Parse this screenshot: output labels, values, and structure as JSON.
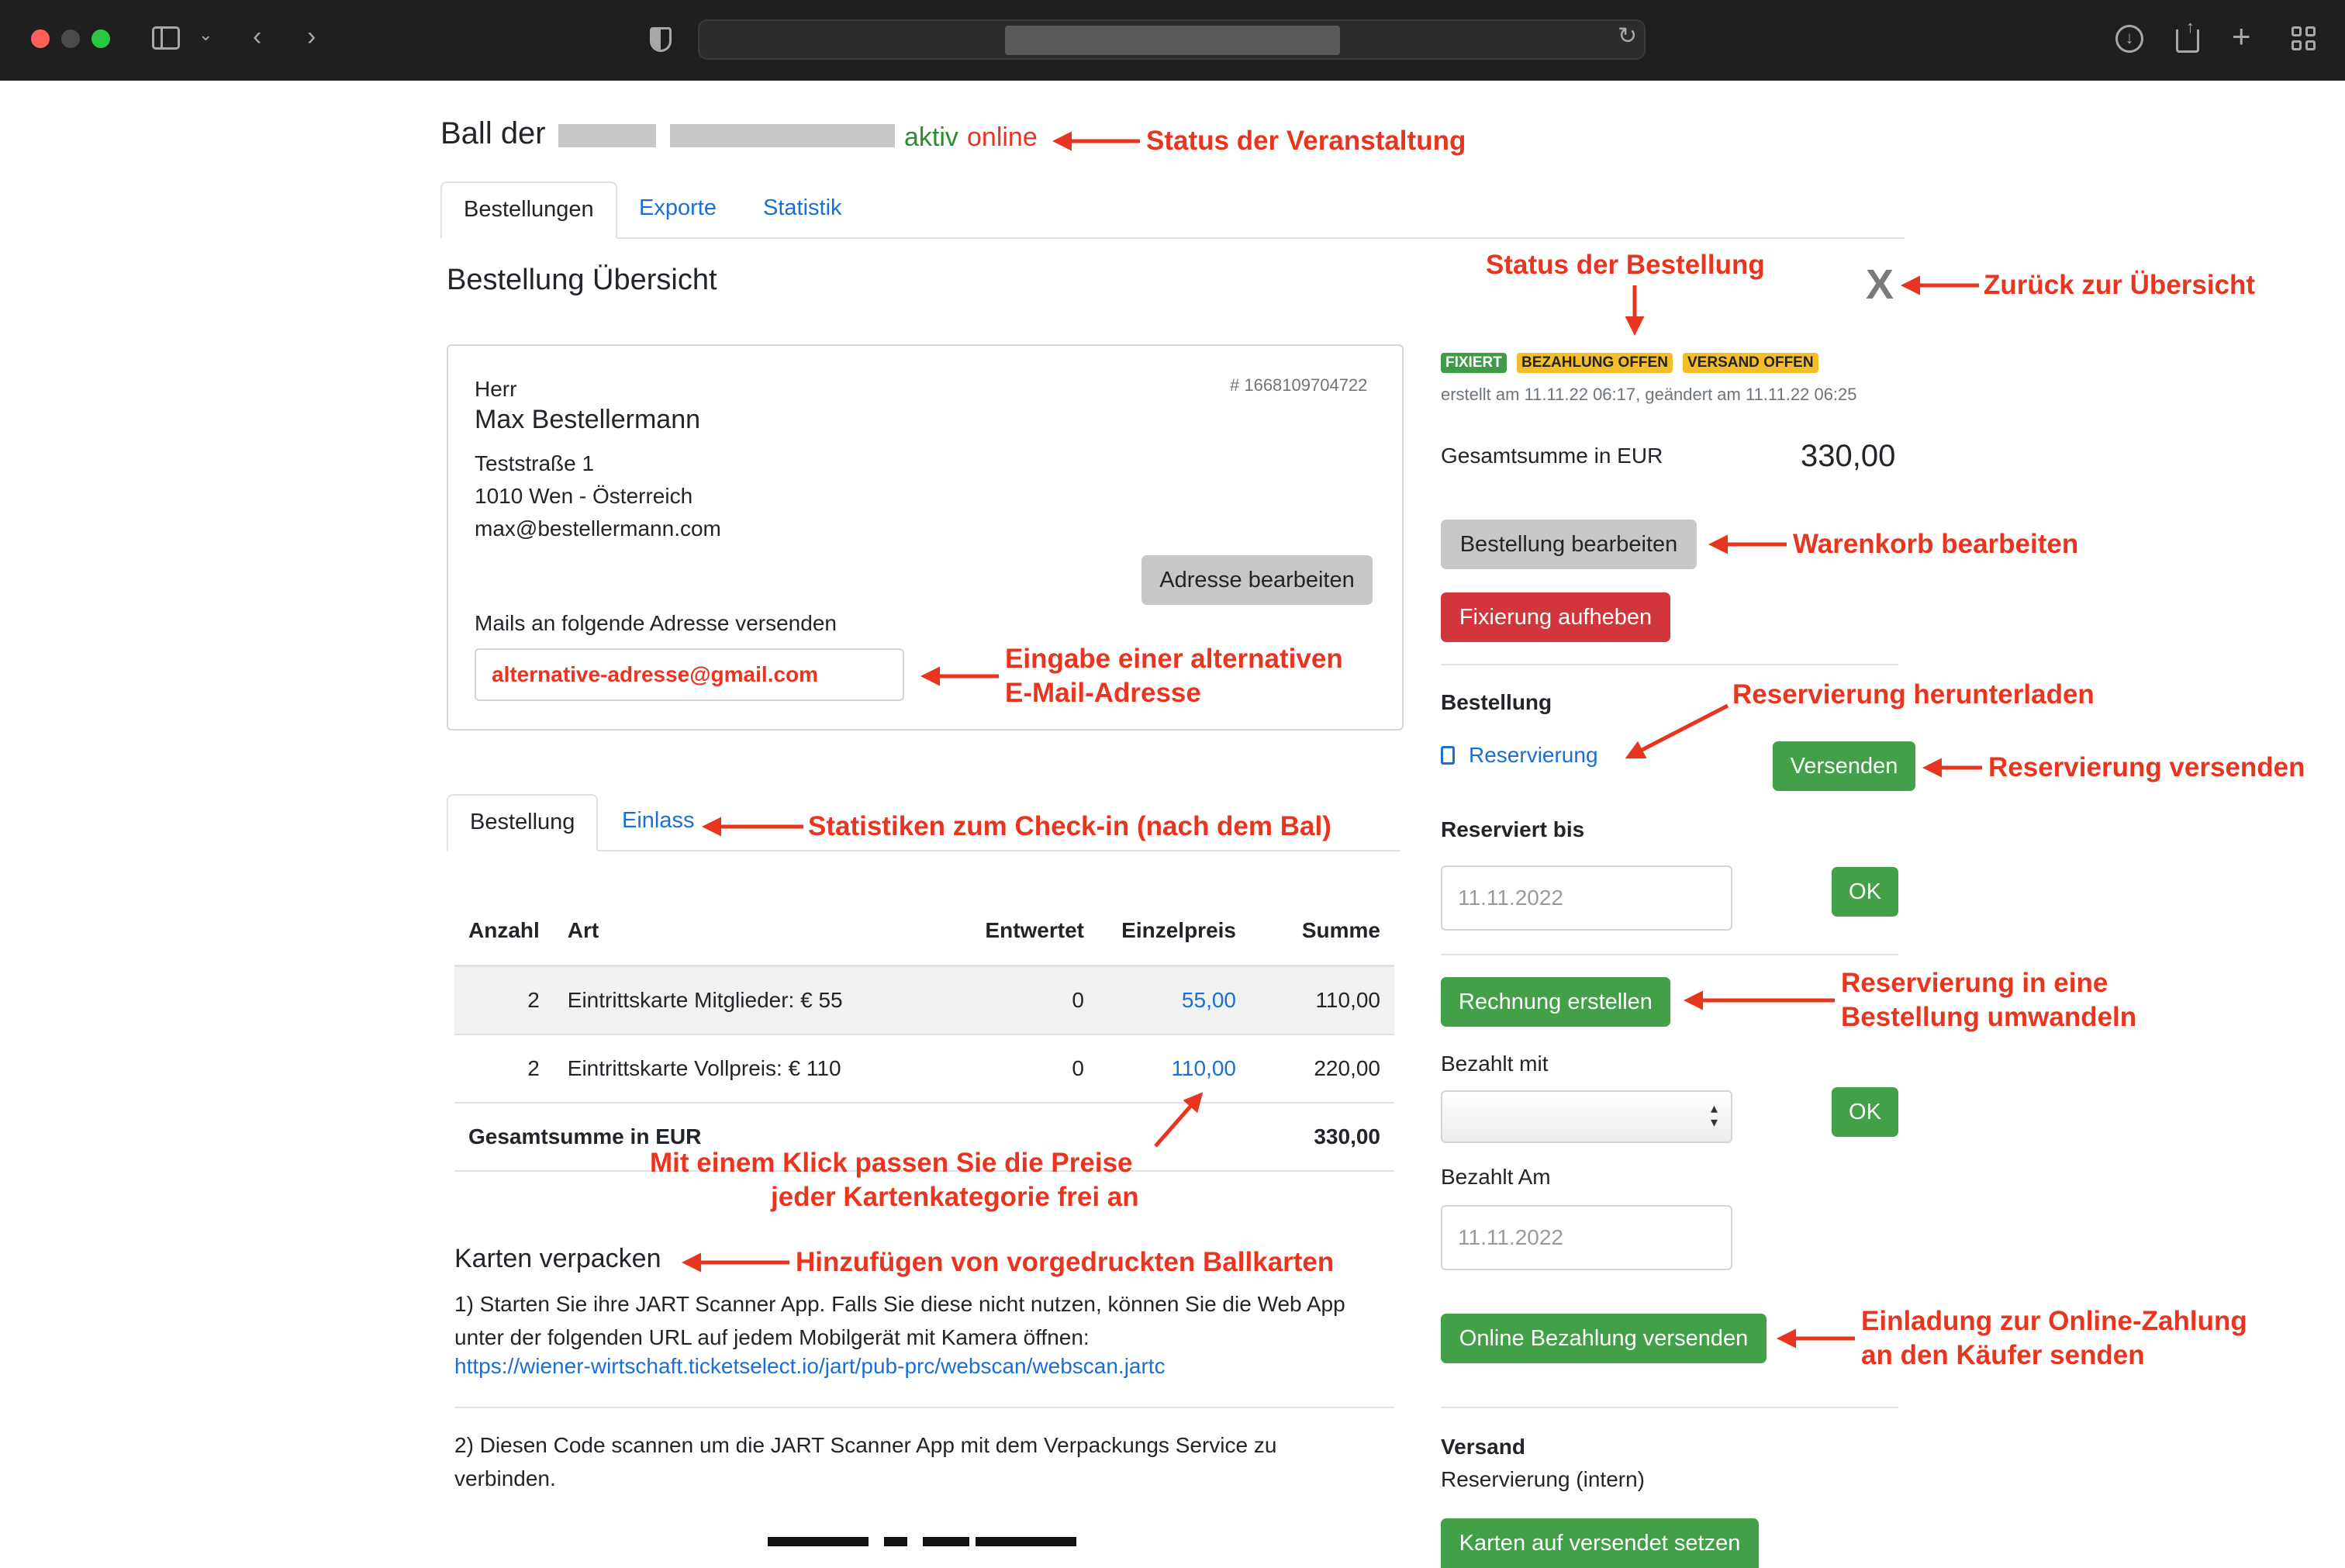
{
  "page": {
    "title_prefix": "Ball der",
    "status_aktiv": "aktiv",
    "status_online": "online",
    "tabs": [
      "Bestellungen",
      "Exporte",
      "Statistik"
    ],
    "section_title": "Bestellung Übersicht",
    "close": "X"
  },
  "address": {
    "salutation": "Herr",
    "name": "Max Bestellermann",
    "order_number": "# 1668109704722",
    "street": "Teststraße 1",
    "city": "1010 Wen - Österreich",
    "email": "max@bestellermann.com",
    "edit_button": "Adresse bearbeiten",
    "mails_label": "Mails an folgende Adresse versenden",
    "mails_value": "alternative-adresse@gmail.com"
  },
  "order_tabs": [
    "Bestellung",
    "Einlass"
  ],
  "table": {
    "headers": [
      "Anzahl",
      "Art",
      "Entwertet",
      "Einzelpreis",
      "Summe"
    ],
    "rows": [
      {
        "qty": "2",
        "type": "Eintrittskarte Mitglieder: € 55",
        "used": "0",
        "price": "55,00",
        "sum": "110,00"
      },
      {
        "qty": "2",
        "type": "Eintrittskarte Vollpreis: € 110",
        "used": "0",
        "price": "110,00",
        "sum": "220,00"
      }
    ],
    "total_label": "Gesamtsumme in EUR",
    "total_value": "330,00"
  },
  "packing": {
    "title": "Karten verpacken",
    "step1": "1) Starten Sie ihre JART Scanner App. Falls Sie diese nicht nutzen, können Sie die Web App unter der folgenden URL auf jedem Mobilgerät mit Kamera öffnen:",
    "url": "https://wiener-wirtschaft.ticketselect.io/jart/pub-prc/webscan/webscan.jartc",
    "step2": "2) Diesen Code scannen um die JART Scanner App mit dem Verpackungs Service zu verbinden."
  },
  "status": {
    "badges": [
      {
        "label": "FIXIERT",
        "color": "#3f9b45",
        "text": "#ffffff"
      },
      {
        "label": "BEZAHLUNG OFFEN",
        "color": "#f4be2a",
        "text": "#212529"
      },
      {
        "label": "VERSAND OFFEN",
        "color": "#f4be2a",
        "text": "#212529"
      }
    ],
    "created": "erstellt am 11.11.22 06:17, geändert am 11.11.22 06:25",
    "total_label": "Gesamtsumme in EUR",
    "total_value": "330,00",
    "edit_order": "Bestellung bearbeiten",
    "unfix": "Fixierung aufheben",
    "order_heading": "Bestellung",
    "reservation_link": "Reservierung",
    "send": "Versenden",
    "reserved_until_label": "Reserviert bis",
    "reserved_until_value": "11.11.2022",
    "ok": "OK",
    "invoice": "Rechnung erstellen",
    "paid_with_label": "Bezahlt mit",
    "paid_with_value": "",
    "paid_on_label": "Bezahlt Am",
    "paid_on_value": "11.11.2022",
    "online_payment": "Online Bezahlung versenden",
    "shipping_heading": "Versand",
    "shipping_value": "Reservierung (intern)",
    "set_shipped": "Karten auf versendet setzen"
  },
  "annotations": {
    "event_status": "Status der Veranstaltung",
    "order_status": "Status der Bestellung",
    "back": "Zurück zur Übersicht",
    "cart": "Warenkorb bearbeiten",
    "alt_email_1": "Eingabe einer alternativen",
    "alt_email_2": "E-Mail-Adresse",
    "download": "Reservierung herunterladen",
    "send_reservation": "Reservierung versenden",
    "checkin_stats": "Statistiken zum Check-in (nach dem Bal)",
    "convert_1": "Reservierung in eine",
    "convert_2": "Bestellung umwandeln",
    "prices_1": "Mit einem Klick passen Sie die Preise",
    "prices_2": "jeder Kartenkategorie frei an",
    "preprinted": "Hinzufügen von vorgedruckten Ballkarten",
    "invite_1": "Einladung zur Online-Zahlung",
    "invite_2": "an den Käufer senden"
  },
  "colors": {
    "annotation": "#e8351f",
    "link": "#1a6fd6",
    "green": "#42a049",
    "red": "#d2363c",
    "status_aktiv": "#2e8b2e",
    "status_online": "#e8351f"
  }
}
